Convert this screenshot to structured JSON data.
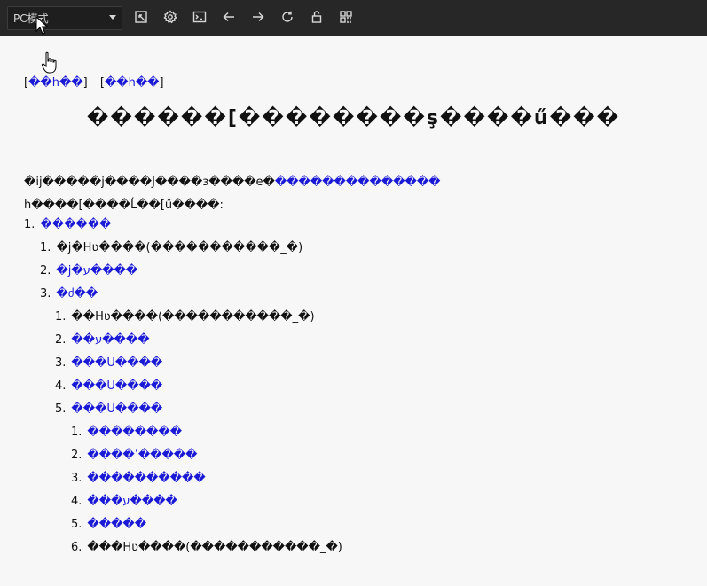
{
  "toolbar": {
    "mode_label": "PC模式",
    "buttons": [
      {
        "name": "expand-icon"
      },
      {
        "name": "settings-icon"
      },
      {
        "name": "terminal-icon"
      },
      {
        "name": "back-icon"
      },
      {
        "name": "forward-icon"
      },
      {
        "name": "refresh-icon"
      },
      {
        "name": "lock-icon"
      },
      {
        "name": "grid-icon"
      }
    ]
  },
  "top_links": {
    "open": "[",
    "link1": "��h��",
    "close": "]",
    "link2": "��h��"
  },
  "page_title": "������[��������ş����ű���",
  "intro": {
    "line1_text": "�ij�����j����J����ɜ����e�",
    "line1_link": "��������������",
    "line2_text": "h����[����Ĺ��[ű����:"
  },
  "tree": [
    {
      "num": "1.",
      "link": "������",
      "text": ""
    },
    {
      "num": "1.",
      "link": "",
      "text": "�j�Hʋ����(�����������_�)"
    },
    {
      "num": "2.",
      "link": "�j�ע����",
      "text": ""
    },
    {
      "num": "3.",
      "link": "�ძ��",
      "text": ""
    },
    {
      "num": "1.",
      "link": "",
      "text": "��Hʋ����(�����������_�)"
    },
    {
      "num": "2.",
      "link": "��ע����",
      "text": ""
    },
    {
      "num": "3.",
      "link": "���Ս����",
      "text": ""
    },
    {
      "num": "4.",
      "link": "���Ս����",
      "text": ""
    },
    {
      "num": "5.",
      "link": "���Ս����",
      "text": ""
    },
    {
      "num": "1.",
      "link": "��������",
      "text": ""
    },
    {
      "num": "2.",
      "link": "����ߵ�����",
      "text": ""
    },
    {
      "num": "3.",
      "link": "����������",
      "text": ""
    },
    {
      "num": "4.",
      "link": "���ע����",
      "text": ""
    },
    {
      "num": "5.",
      "link": "�����",
      "text": ""
    },
    {
      "num": "6.",
      "link": "",
      "text": "���Hʋ����(�����������_�)"
    }
  ],
  "colors": {
    "toolbar_bg": "#272727",
    "link": "#1a1ad6",
    "page_bg": "#f7f7f7"
  }
}
